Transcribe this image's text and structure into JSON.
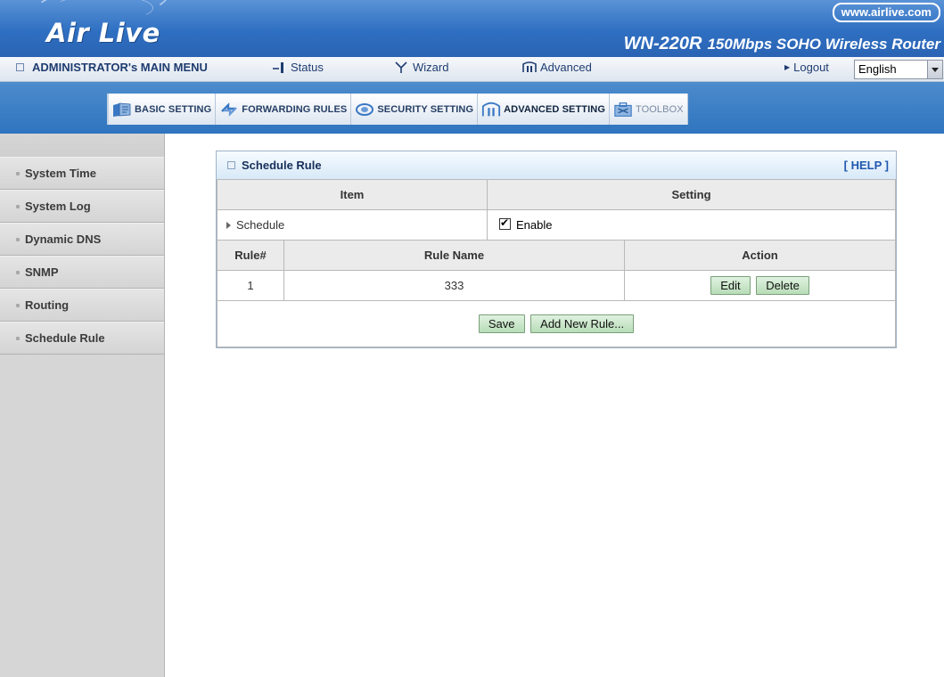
{
  "brand": {
    "logo": "Air Live",
    "url": "www.airlive.com",
    "model_code": "WN-220R",
    "model_desc": "150Mbps SOHO Wireless Router"
  },
  "menu": {
    "admin": "ADMINISTRATOR's MAIN MENU",
    "status": "Status",
    "wizard": "Wizard",
    "advanced": "Advanced",
    "logout": "Logout",
    "language": "English"
  },
  "tabs": [
    {
      "label": "BASIC SETTING",
      "icon": "folder-icon"
    },
    {
      "label": "FORWARDING RULES",
      "icon": "arrows-icon"
    },
    {
      "label": "SECURITY SETTING",
      "icon": "eye-icon"
    },
    {
      "label": "ADVANCED SETTING",
      "icon": "advanced-icon"
    },
    {
      "label": "TOOLBOX",
      "icon": "toolbox-icon"
    }
  ],
  "sidebar": [
    {
      "label": "System Time"
    },
    {
      "label": "System Log"
    },
    {
      "label": "Dynamic DNS"
    },
    {
      "label": "SNMP"
    },
    {
      "label": "Routing"
    },
    {
      "label": "Schedule Rule"
    }
  ],
  "panel": {
    "title": "Schedule Rule",
    "help": "[ HELP ]",
    "col_item": "Item",
    "col_setting": "Setting",
    "schedule_label": "Schedule",
    "enable_label": "Enable",
    "rules_header": {
      "rule_no": "Rule#",
      "rule_name": "Rule Name",
      "action": "Action"
    },
    "rules": [
      {
        "no": "1",
        "name": "333"
      }
    ],
    "edit_btn": "Edit",
    "delete_btn": "Delete",
    "save_btn": "Save",
    "add_btn": "Add New Rule..."
  }
}
